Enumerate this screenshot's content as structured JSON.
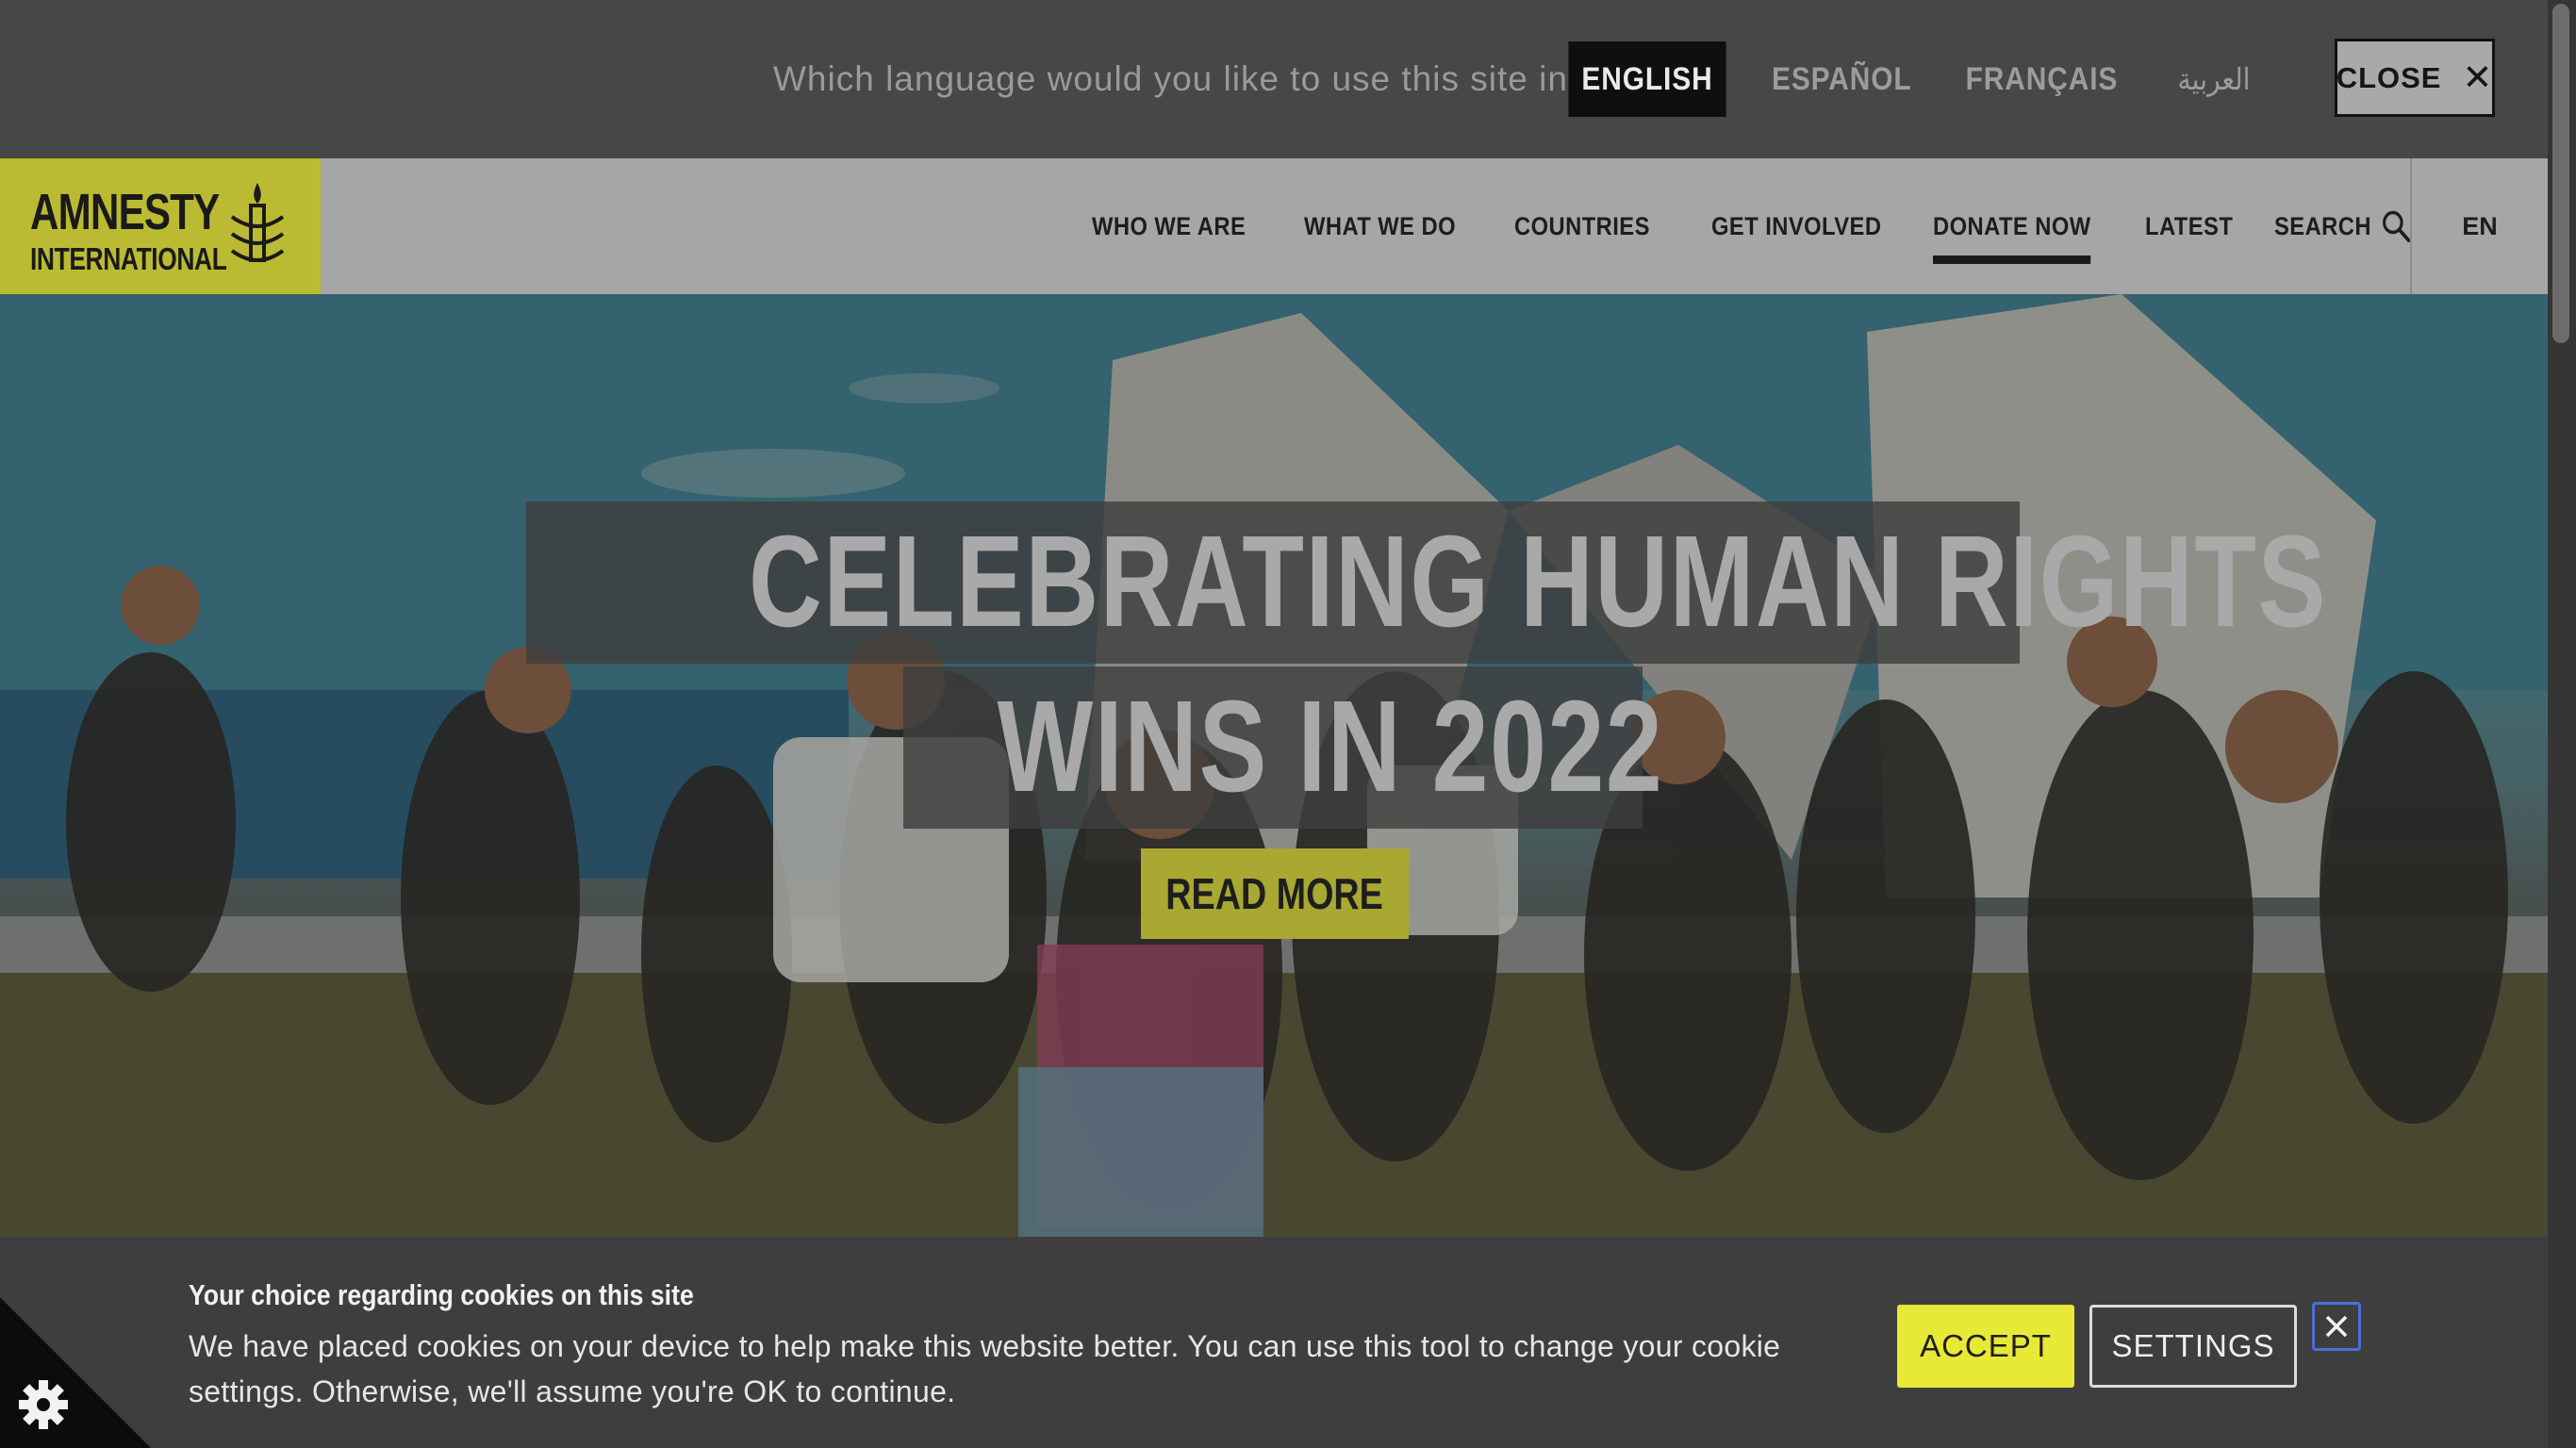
{
  "language_bar": {
    "prompt": "Which language would you like to use this site in?",
    "options": [
      {
        "label": "ENGLISH",
        "selected": true
      },
      {
        "label": "ESPAÑOL",
        "selected": false
      },
      {
        "label": "FRANÇAIS",
        "selected": false
      },
      {
        "label": "العربية",
        "selected": false
      }
    ],
    "close_label": "CLOSE",
    "close_icon": "close-icon"
  },
  "header": {
    "logo": {
      "line1": "AMNESTY",
      "line2": "INTERNATIONAL",
      "icon": "candle-icon",
      "color": "#bbbb33"
    },
    "nav": [
      {
        "label": "WHO WE ARE"
      },
      {
        "label": "WHAT WE DO"
      },
      {
        "label": "COUNTRIES"
      },
      {
        "label": "GET INVOLVED"
      },
      {
        "label": "DONATE NOW",
        "active": true
      },
      {
        "label": "LATEST"
      },
      {
        "label": "SEARCH",
        "icon": "search-icon"
      }
    ],
    "language_code": "EN"
  },
  "hero": {
    "headline_line1": "CELEBRATING HUMAN RIGHTS",
    "headline_line2": "WINS IN 2022",
    "cta_label": "READ MORE",
    "cta_color": "#a8a833"
  },
  "cookie_banner": {
    "title": "Your choice regarding cookies on this site",
    "body": "We have placed cookies on your device to help make this website better. You can use this tool to change your cookie settings. Otherwise, we'll assume you're OK to continue.",
    "accept_label": "ACCEPT",
    "settings_label": "SETTINGS",
    "accept_color": "#e8e836",
    "close_icon": "close-icon",
    "widget_icon": "gear-icon"
  }
}
